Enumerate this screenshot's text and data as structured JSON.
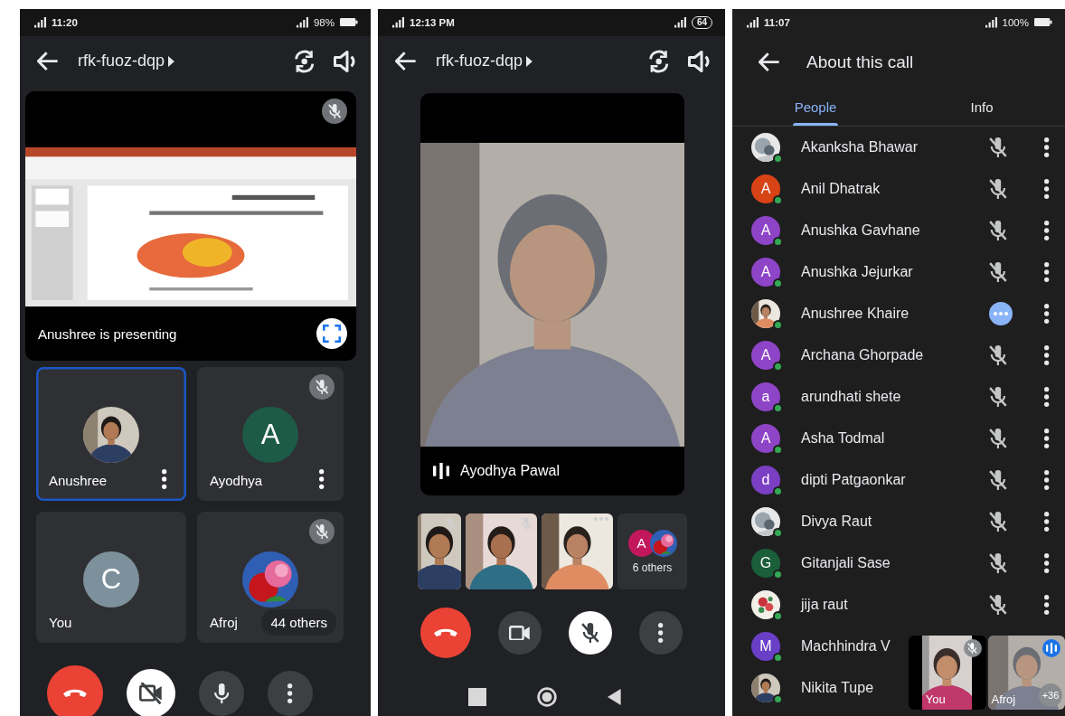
{
  "meeting_grid": {
    "status_bar": {
      "time": "11:20",
      "battery": "98%"
    },
    "header": {
      "title": "rfk-fuoz-dqp"
    },
    "presentation": {
      "caption": "Anushree is presenting",
      "muted": true
    },
    "tiles": [
      {
        "name": "Anushree",
        "avatar": {
          "kind": "picture"
        },
        "selected": true,
        "muted": false,
        "menu": true
      },
      {
        "name": "Ayodhya",
        "avatar": {
          "kind": "letter",
          "letter": "A",
          "color": "#1d5b47"
        },
        "selected": false,
        "muted": true,
        "menu": true
      },
      {
        "name": "You",
        "avatar": {
          "kind": "letter",
          "letter": "C",
          "color": "#7d919c"
        },
        "selected": false,
        "muted": false,
        "menu": false
      },
      {
        "name": "Afroj",
        "avatar": {
          "kind": "picture"
        },
        "selected": false,
        "muted": true,
        "menu": false,
        "others": "44 others"
      }
    ],
    "controls": [
      {
        "kind": "end-call"
      },
      {
        "kind": "camera",
        "on": false
      },
      {
        "kind": "mic",
        "on": true
      },
      {
        "kind": "more"
      }
    ]
  },
  "meeting_speaker": {
    "status_bar": {
      "time": "12:13 PM",
      "battery": "64"
    },
    "header": {
      "title": "rfk-fuoz-dqp"
    },
    "speaker": {
      "name": "Ayodhya Pawal",
      "speaking": true
    },
    "thumbnails": [
      {
        "kind": "video",
        "speaking": false
      },
      {
        "kind": "video",
        "speaking": false
      },
      {
        "kind": "video",
        "speaking": true
      },
      {
        "kind": "others",
        "label": "6 others",
        "avatars": [
          {
            "kind": "letter",
            "letter": "A",
            "color": "#c2185b"
          },
          {
            "kind": "picture"
          }
        ]
      }
    ],
    "controls": [
      {
        "kind": "end-call"
      },
      {
        "kind": "camera",
        "on": true
      },
      {
        "kind": "mic",
        "on": false
      },
      {
        "kind": "more"
      }
    ]
  },
  "call_details": {
    "status_bar": {
      "time": "11:07",
      "battery": "100%"
    },
    "header": {
      "title": "About this call"
    },
    "tabs": [
      {
        "label": "People",
        "selected": true
      },
      {
        "label": "Info",
        "selected": false
      }
    ],
    "people": [
      {
        "name": "Akanksha Bhawar",
        "avatar": {
          "kind": "picture"
        },
        "speaking": false,
        "menu": true
      },
      {
        "name": "Anil Dhatrak",
        "avatar": {
          "kind": "letter",
          "letter": "A",
          "color": "#d84315"
        },
        "speaking": false,
        "menu": true
      },
      {
        "name": "Anushka Gavhane",
        "avatar": {
          "kind": "letter",
          "letter": "A",
          "color": "#8e44c6"
        },
        "speaking": false,
        "menu": true
      },
      {
        "name": "Anushka Jejurkar",
        "avatar": {
          "kind": "letter",
          "letter": "A",
          "color": "#8e44c6"
        },
        "speaking": false,
        "menu": true
      },
      {
        "name": "Anushree Khaire",
        "avatar": {
          "kind": "picture"
        },
        "speaking": true,
        "menu": true
      },
      {
        "name": "Archana Ghorpade",
        "avatar": {
          "kind": "letter",
          "letter": "A",
          "color": "#8e44c6"
        },
        "speaking": false,
        "menu": true
      },
      {
        "name": "arundhati shete",
        "avatar": {
          "kind": "letter",
          "letter": "a",
          "color": "#8e44c6"
        },
        "speaking": false,
        "menu": true
      },
      {
        "name": "Asha Todmal",
        "avatar": {
          "kind": "letter",
          "letter": "A",
          "color": "#8e44c6"
        },
        "speaking": false,
        "menu": true
      },
      {
        "name": "dipti Patgaonkar",
        "avatar": {
          "kind": "letter",
          "letter": "d",
          "color": "#7b3fc4"
        },
        "speaking": false,
        "menu": true
      },
      {
        "name": "Divya Raut",
        "avatar": {
          "kind": "picture"
        },
        "speaking": false,
        "menu": true
      },
      {
        "name": "Gitanjali Sase",
        "avatar": {
          "kind": "letter",
          "letter": "G",
          "color": "#1b5e3a"
        },
        "speaking": false,
        "menu": true
      },
      {
        "name": "jija raut",
        "avatar": {
          "kind": "picture"
        },
        "speaking": false,
        "menu": true
      },
      {
        "name": "Machhindra V",
        "avatar": {
          "kind": "letter",
          "letter": "M",
          "color": "#6a3fc8"
        }
      },
      {
        "name": "Nikita Tupe",
        "avatar": {
          "kind": "picture"
        }
      }
    ],
    "pip": [
      {
        "name": "You",
        "speaking": false
      },
      {
        "name": "Afroj",
        "speaking": true,
        "extra": "+36"
      }
    ]
  }
}
